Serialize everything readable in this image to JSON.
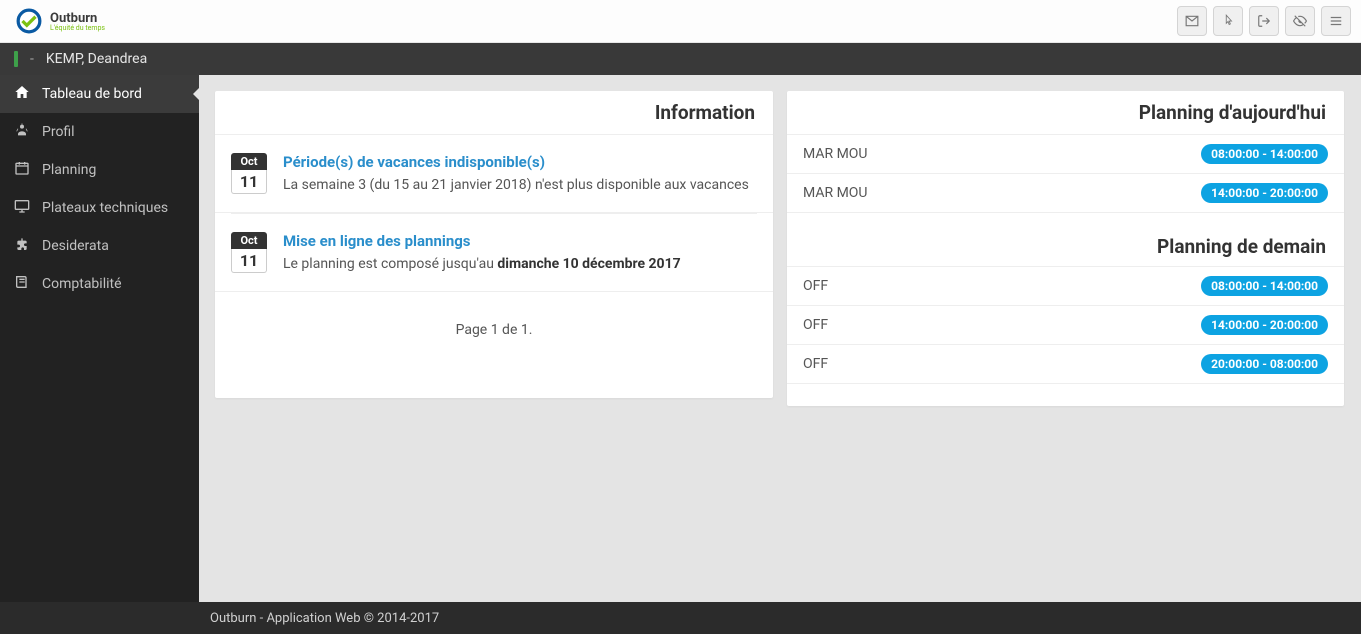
{
  "brand": {
    "name": "Outburn",
    "tagline": "L'équité du temps"
  },
  "user": {
    "status_sep": "-",
    "name": "KEMP, Deandrea"
  },
  "sidebar": {
    "items": [
      {
        "label": "Tableau de bord",
        "icon": "home"
      },
      {
        "label": "Profil",
        "icon": "user"
      },
      {
        "label": "Planning",
        "icon": "calendar"
      },
      {
        "label": "Plateaux techniques",
        "icon": "monitor"
      },
      {
        "label": "Desiderata",
        "icon": "puzzle"
      },
      {
        "label": "Comptabilité",
        "icon": "book"
      }
    ]
  },
  "info_panel": {
    "title": "Information",
    "items": [
      {
        "month": "Oct",
        "day": "11",
        "title": "Période(s) de vacances indisponible(s)",
        "desc_pre": "La semaine 3 (du 15 au 21 janvier 2018) n'est plus disponible aux vacances",
        "desc_strong": ""
      },
      {
        "month": "Oct",
        "day": "11",
        "title": "Mise en ligne des plannings",
        "desc_pre": "Le planning est composé jusqu'au ",
        "desc_strong": "dimanche 10 décembre 2017"
      }
    ],
    "pagination": "Page 1 de 1."
  },
  "planning_today": {
    "title": "Planning d'aujourd'hui",
    "rows": [
      {
        "label": "MAR MOU",
        "time": "08:00:00 - 14:00:00"
      },
      {
        "label": "MAR MOU",
        "time": "14:00:00 - 20:00:00"
      }
    ]
  },
  "planning_tomorrow": {
    "title": "Planning de demain",
    "rows": [
      {
        "label": "OFF",
        "time": "08:00:00 - 14:00:00"
      },
      {
        "label": "OFF",
        "time": "14:00:00 - 20:00:00"
      },
      {
        "label": "OFF",
        "time": "20:00:00 - 08:00:00"
      }
    ]
  },
  "footer": {
    "text": "Outburn - Application Web © 2014-2017"
  }
}
